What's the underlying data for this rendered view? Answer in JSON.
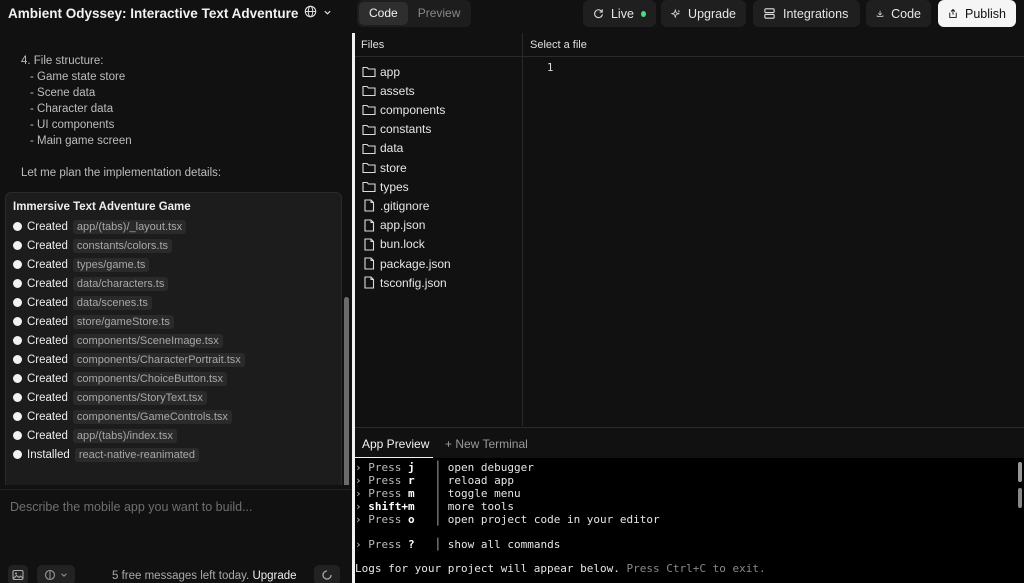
{
  "header": {
    "app_title": "Ambient Odyssey: Interactive Text Adventure",
    "globe_icon": "globe-icon",
    "chevron_icon": "chevron-down-icon",
    "view_tabs": [
      {
        "label": "Code",
        "active": true
      },
      {
        "label": "Preview",
        "active": false
      }
    ],
    "live_label": "Live",
    "upgrade_label": "Upgrade",
    "integrations_label": "Integrations",
    "code_label": "Code",
    "publish_label": "Publish"
  },
  "chat": {
    "lines": [
      {
        "text": "4. File structure:",
        "indent": 0
      },
      {
        "text": "- Game state store",
        "indent": 1
      },
      {
        "text": "- Scene data",
        "indent": 1
      },
      {
        "text": "- Character data",
        "indent": 1
      },
      {
        "text": "- UI components",
        "indent": 1
      },
      {
        "text": "- Main game screen",
        "indent": 1
      }
    ],
    "plan_line": "Let me plan the implementation details:",
    "artifact": {
      "title": "Immersive Text Adventure Game",
      "items": [
        {
          "verb": "Created",
          "path": "app/(tabs)/_layout.tsx"
        },
        {
          "verb": "Created",
          "path": "constants/colors.ts"
        },
        {
          "verb": "Created",
          "path": "types/game.ts"
        },
        {
          "verb": "Created",
          "path": "data/characters.ts"
        },
        {
          "verb": "Created",
          "path": "data/scenes.ts"
        },
        {
          "verb": "Created",
          "path": "store/gameStore.ts"
        },
        {
          "verb": "Created",
          "path": "components/SceneImage.tsx"
        },
        {
          "verb": "Created",
          "path": "components/CharacterPortrait.tsx"
        },
        {
          "verb": "Created",
          "path": "components/ChoiceButton.tsx"
        },
        {
          "verb": "Created",
          "path": "components/StoryText.tsx"
        },
        {
          "verb": "Created",
          "path": "components/GameControls.tsx"
        },
        {
          "verb": "Created",
          "path": "app/(tabs)/index.tsx"
        },
        {
          "verb": "Installed",
          "path": "react-native-reanimated"
        }
      ]
    }
  },
  "prompt": {
    "placeholder": "Describe the mobile app you want to build...",
    "free_messages": "5 free messages left today.",
    "upgrade_link": "Upgrade"
  },
  "files": {
    "header": "Files",
    "items": [
      {
        "name": "app",
        "type": "folder"
      },
      {
        "name": "assets",
        "type": "folder"
      },
      {
        "name": "components",
        "type": "folder"
      },
      {
        "name": "constants",
        "type": "folder"
      },
      {
        "name": "data",
        "type": "folder"
      },
      {
        "name": "store",
        "type": "folder"
      },
      {
        "name": "types",
        "type": "folder"
      },
      {
        "name": ".gitignore",
        "type": "file"
      },
      {
        "name": "app.json",
        "type": "file"
      },
      {
        "name": "bun.lock",
        "type": "file"
      },
      {
        "name": "package.json",
        "type": "file"
      },
      {
        "name": "tsconfig.json",
        "type": "file"
      }
    ]
  },
  "editor": {
    "header": "Select a file",
    "line_number": "1"
  },
  "terminal": {
    "tabs": [
      {
        "label": "App Preview",
        "active": true
      },
      {
        "label": "+ New Terminal",
        "active": false
      }
    ],
    "lines": [
      {
        "prefix": "› Press",
        "key": "j",
        "desc": "open debugger"
      },
      {
        "prefix": "› Press",
        "key": "r",
        "desc": "reload app"
      },
      {
        "prefix": "› Press",
        "key": "m",
        "desc": "toggle menu"
      },
      {
        "prefix": "›",
        "key": "shift+m",
        "desc": "more tools"
      },
      {
        "prefix": "› Press",
        "key": "o",
        "desc": "open project code in your editor"
      },
      {
        "prefix": "› Press",
        "key": "?",
        "desc": "show all commands"
      }
    ],
    "logs_line": "Logs for your project will appear below.",
    "logs_hint": "Press Ctrl+C to exit."
  }
}
